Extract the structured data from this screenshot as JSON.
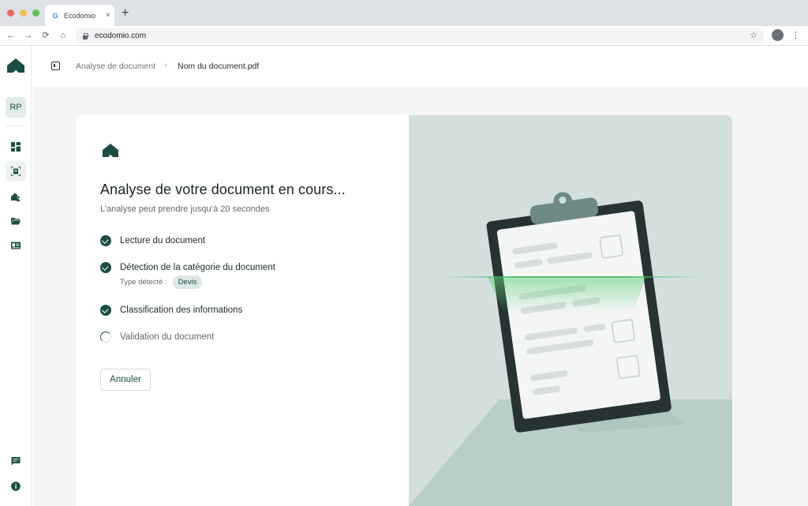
{
  "browser": {
    "tab_title": "Ecodomio",
    "tab_close": "×",
    "new_tab": "+",
    "url": "ecodomio.com",
    "nav": {
      "back": "←",
      "forward": "→",
      "reload": "⟳",
      "home": "⌂"
    },
    "star": "☆",
    "menu": "⋮"
  },
  "sidebar": {
    "avatar_initials": "RP",
    "items": [
      {
        "icon": "dashboard-icon"
      },
      {
        "icon": "document-scan-icon",
        "active": true
      },
      {
        "icon": "house-person-icon"
      },
      {
        "icon": "folder-icon"
      },
      {
        "icon": "id-card-icon"
      },
      {
        "icon": "chat-icon"
      },
      {
        "icon": "info-icon"
      }
    ]
  },
  "header": {
    "breadcrumb": [
      "Analyse de document",
      "Nom du document.pdf"
    ],
    "separator": "›"
  },
  "analysis": {
    "title": "Analyse de votre document en cours...",
    "subtitle": "L’analyse peut prendre jusqu’à 20 secondes",
    "steps": [
      {
        "label": "Lecture du document",
        "status": "done"
      },
      {
        "label": "Détection de la catégorie du document",
        "status": "done"
      },
      {
        "label": "Classification des informations",
        "status": "done"
      },
      {
        "label": "Validation du document",
        "status": "in-progress"
      }
    ],
    "detected_type_label": "Type détecté :",
    "detected_type_value": "Devis",
    "cancel_label": "Annuler"
  },
  "colors": {
    "brand": "#1b4d46",
    "illustration_bg": "#d3dfdd",
    "scan_line": "#5fd07a"
  }
}
